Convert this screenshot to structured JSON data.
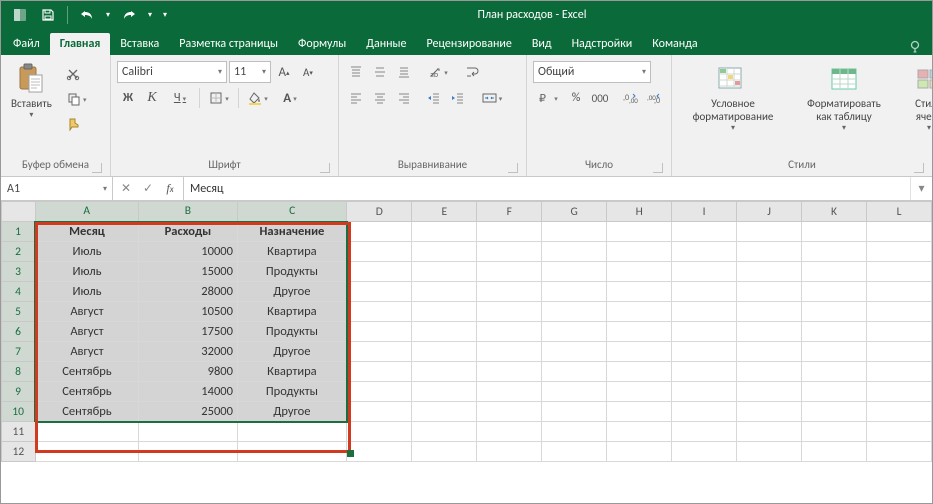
{
  "title": "План расходов - Excel",
  "tabs": [
    "Файл",
    "Главная",
    "Вставка",
    "Разметка страницы",
    "Формулы",
    "Данные",
    "Рецензирование",
    "Вид",
    "Надстройки",
    "Команда"
  ],
  "active_tab_index": 1,
  "ribbon": {
    "clipboard": {
      "paste": "Вставить",
      "group": "Буфер обмена"
    },
    "font": {
      "font_name": "Calibri",
      "font_size": "11",
      "group": "Шрифт",
      "bold": "Ж",
      "italic": "К",
      "underline": "Ч"
    },
    "alignment": {
      "group": "Выравнивание"
    },
    "number": {
      "format": "Общий",
      "group": "Число"
    },
    "styles": {
      "cond": "Условное\nформатирование",
      "table": "Форматировать\nкак таблицу",
      "cell": "Стили\nячеек",
      "group": "Стили"
    }
  },
  "namebox": "A1",
  "formula": "Месяц",
  "columns": [
    "A",
    "B",
    "C",
    "D",
    "E",
    "F",
    "G",
    "H",
    "I",
    "J",
    "K",
    "L"
  ],
  "row_count": 12,
  "data": {
    "headers": [
      "Месяц",
      "Расходы",
      "Назначение"
    ],
    "rows": [
      [
        "Июль",
        "10000",
        "Квартира"
      ],
      [
        "Июль",
        "15000",
        "Продукты"
      ],
      [
        "Июль",
        "28000",
        "Другое"
      ],
      [
        "Август",
        "10500",
        "Квартира"
      ],
      [
        "Август",
        "17500",
        "Продукты"
      ],
      [
        "Август",
        "32000",
        "Другое"
      ],
      [
        "Сентябрь",
        "9800",
        "Квартира"
      ],
      [
        "Сентябрь",
        "14000",
        "Продукты"
      ],
      [
        "Сентябрь",
        "25000",
        "Другое"
      ]
    ]
  },
  "selection": {
    "from": {
      "r": 1,
      "c": 1
    },
    "to": {
      "r": 10,
      "c": 3
    }
  }
}
